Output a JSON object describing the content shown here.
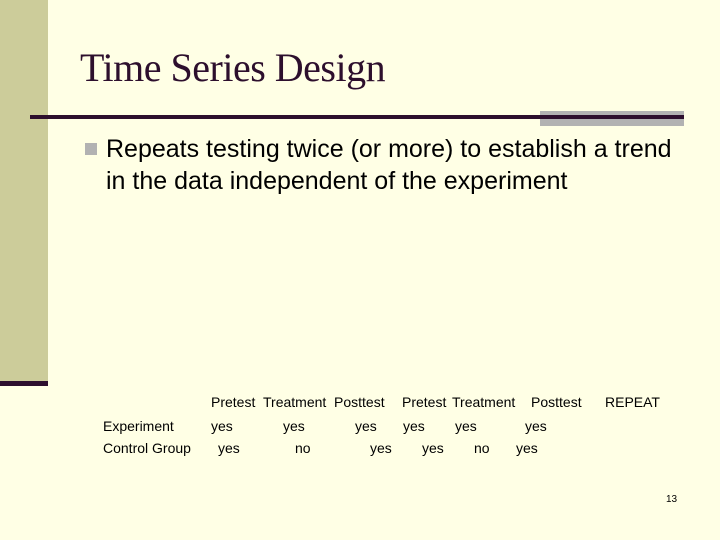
{
  "slide": {
    "title": "Time Series Design",
    "bullets": [
      {
        "text": "Repeats testing twice (or more) to establish a trend in the data independent of the experiment"
      }
    ],
    "table": {
      "headers": [
        "Pretest",
        "Treatment",
        "Posttest",
        "Pretest",
        "Treatment",
        "Posttest",
        "REPEAT"
      ],
      "rows": [
        {
          "label": "Experiment",
          "cells": [
            "yes",
            "yes",
            "yes",
            "yes",
            "yes",
            "yes"
          ]
        },
        {
          "label": "Control Group",
          "cells": [
            "yes",
            "no",
            "yes",
            "yes",
            "no",
            "yes"
          ]
        }
      ]
    },
    "page_number": "13"
  },
  "colors": {
    "background": "#ffffe5",
    "sidebar": "#cccc9a",
    "title_text": "#2d0f2d",
    "rule": "#2d0f2d",
    "accent_gray": "#b2b2b2"
  }
}
